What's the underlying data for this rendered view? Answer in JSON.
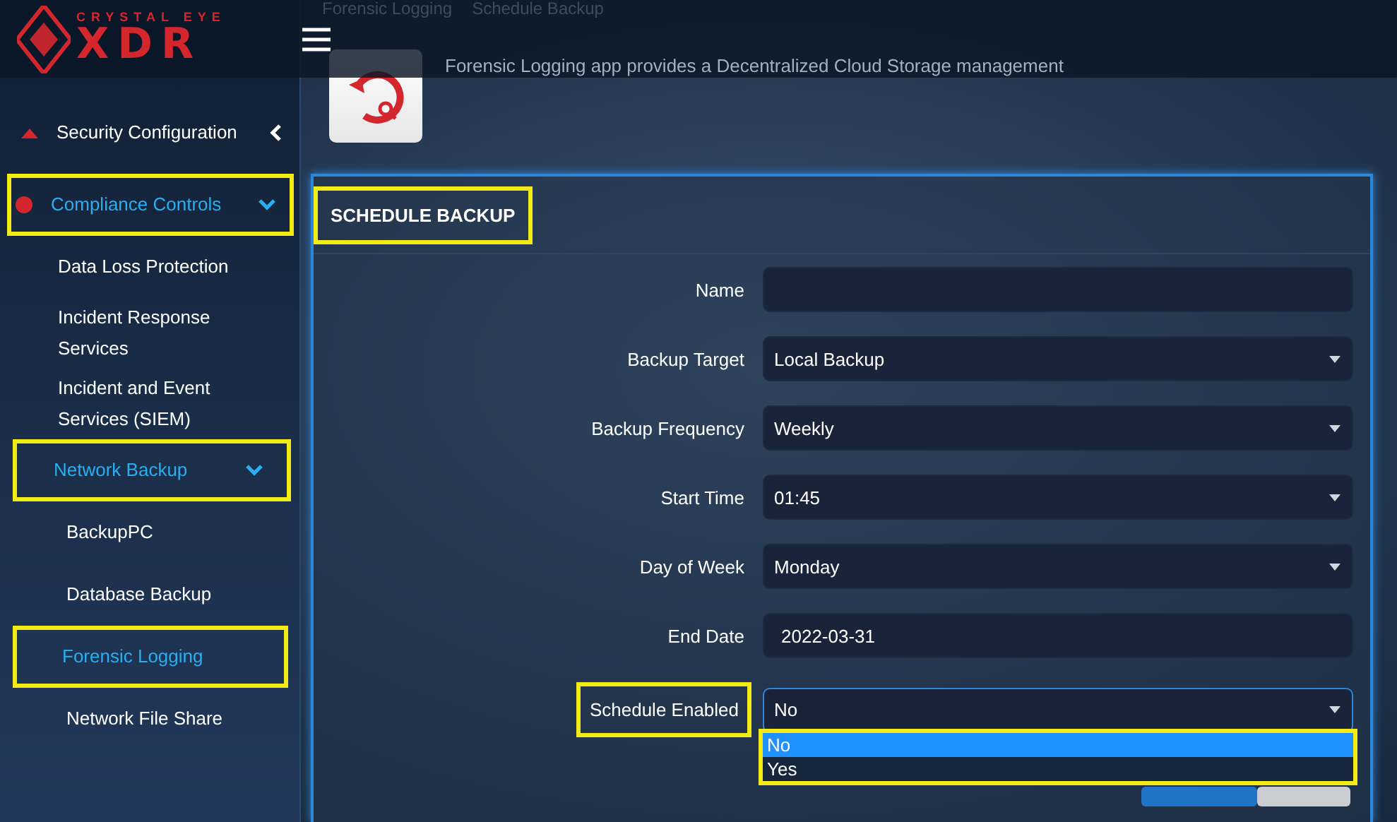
{
  "header": {
    "breadcrumb": [
      "Forensic Logging",
      "Schedule Backup"
    ],
    "logo": {
      "tagline": "CRYSTAL EYE",
      "wordmark": "XDR"
    }
  },
  "sidebar": {
    "items": [
      {
        "label": "Security Configuration",
        "expanded": false,
        "selected": false,
        "highlighted": false
      },
      {
        "label": "Compliance Controls",
        "expanded": true,
        "selected": true,
        "highlighted": true,
        "children": [
          {
            "label": "Data Loss Protection",
            "selected": false,
            "highlighted": false
          },
          {
            "label": "Incident Response Services",
            "selected": false,
            "highlighted": false
          },
          {
            "label": "Incident and Event Services (SIEM)",
            "selected": false,
            "highlighted": false
          },
          {
            "label": "Network Backup",
            "expanded": true,
            "selected": true,
            "highlighted": true,
            "children": [
              {
                "label": "BackupPC",
                "selected": false,
                "highlighted": false
              },
              {
                "label": "Database Backup",
                "selected": false,
                "highlighted": false
              },
              {
                "label": "Forensic Logging",
                "selected": true,
                "highlighted": true
              },
              {
                "label": "Network File Share",
                "selected": false,
                "highlighted": false
              }
            ]
          }
        ]
      }
    ]
  },
  "app": {
    "description": "Forensic Logging app provides a Decentralized Cloud Storage management"
  },
  "panel": {
    "title": "SCHEDULE BACKUP",
    "highlighted": true,
    "fields": [
      {
        "label": "Name",
        "kind": "text",
        "highlighted": false
      },
      {
        "label": "Backup Target",
        "kind": "select",
        "value": "Local Backup",
        "highlighted": false
      },
      {
        "label": "Backup Frequency",
        "kind": "select",
        "value": "Weekly",
        "highlighted": false
      },
      {
        "label": "Start Time",
        "kind": "select",
        "value": "01:45",
        "highlighted": false
      },
      {
        "label": "Day of Week",
        "kind": "select",
        "value": "Monday",
        "highlighted": false
      },
      {
        "label": "End Date",
        "kind": "date",
        "value": "2022-03-31",
        "highlighted": false
      },
      {
        "label": "Schedule Enabled",
        "kind": "select",
        "value": "No",
        "highlighted": true,
        "open": true,
        "options": [
          {
            "label": "No",
            "selected": true
          },
          {
            "label": "Yes",
            "selected": false
          }
        ]
      }
    ]
  }
}
